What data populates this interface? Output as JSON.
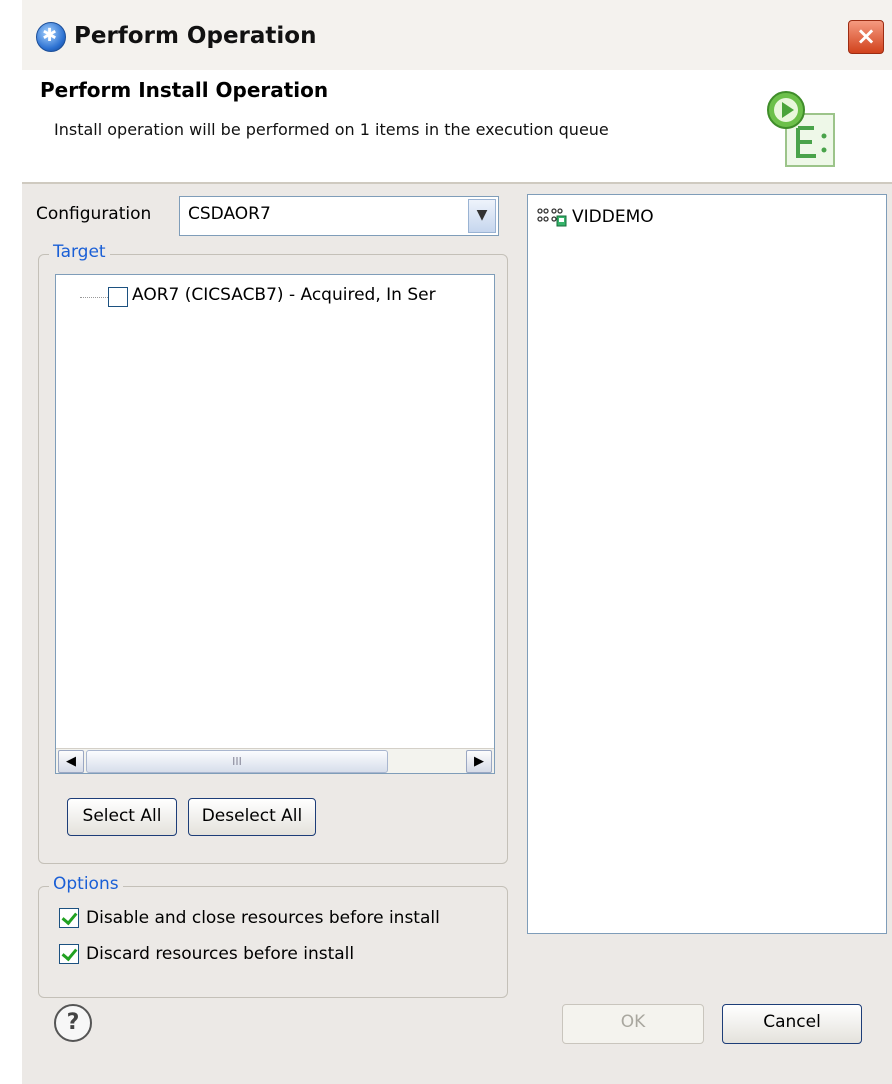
{
  "window": {
    "title": "Perform Operation",
    "close_glyph": "×"
  },
  "header": {
    "title": "Perform Install Operation",
    "description": "Install operation will be performed on 1 items in the execution queue"
  },
  "configuration": {
    "label": "Configuration",
    "value": "CSDAOR7"
  },
  "target": {
    "group_label": "Target",
    "items": [
      {
        "label": "AOR7 (CICSACB7) - Acquired, In Ser",
        "checked": false
      }
    ],
    "scroll_grip": "III",
    "select_all_label": "Select All",
    "deselect_all_label": "Deselect All"
  },
  "options": {
    "group_label": "Options",
    "items": [
      {
        "label": "Disable and close resources before install",
        "checked": true
      },
      {
        "label": "Discard resources before install",
        "checked": true
      }
    ]
  },
  "queue": {
    "items": [
      {
        "label": "VIDDEMO",
        "icon": "resource-group-icon"
      }
    ]
  },
  "footer": {
    "help_glyph": "?",
    "ok_label": "OK",
    "cancel_label": "Cancel",
    "ok_enabled": false
  },
  "colors": {
    "group_label": "#1a5fd6",
    "check_mark": "#21a121",
    "background": "#ece9e6"
  }
}
